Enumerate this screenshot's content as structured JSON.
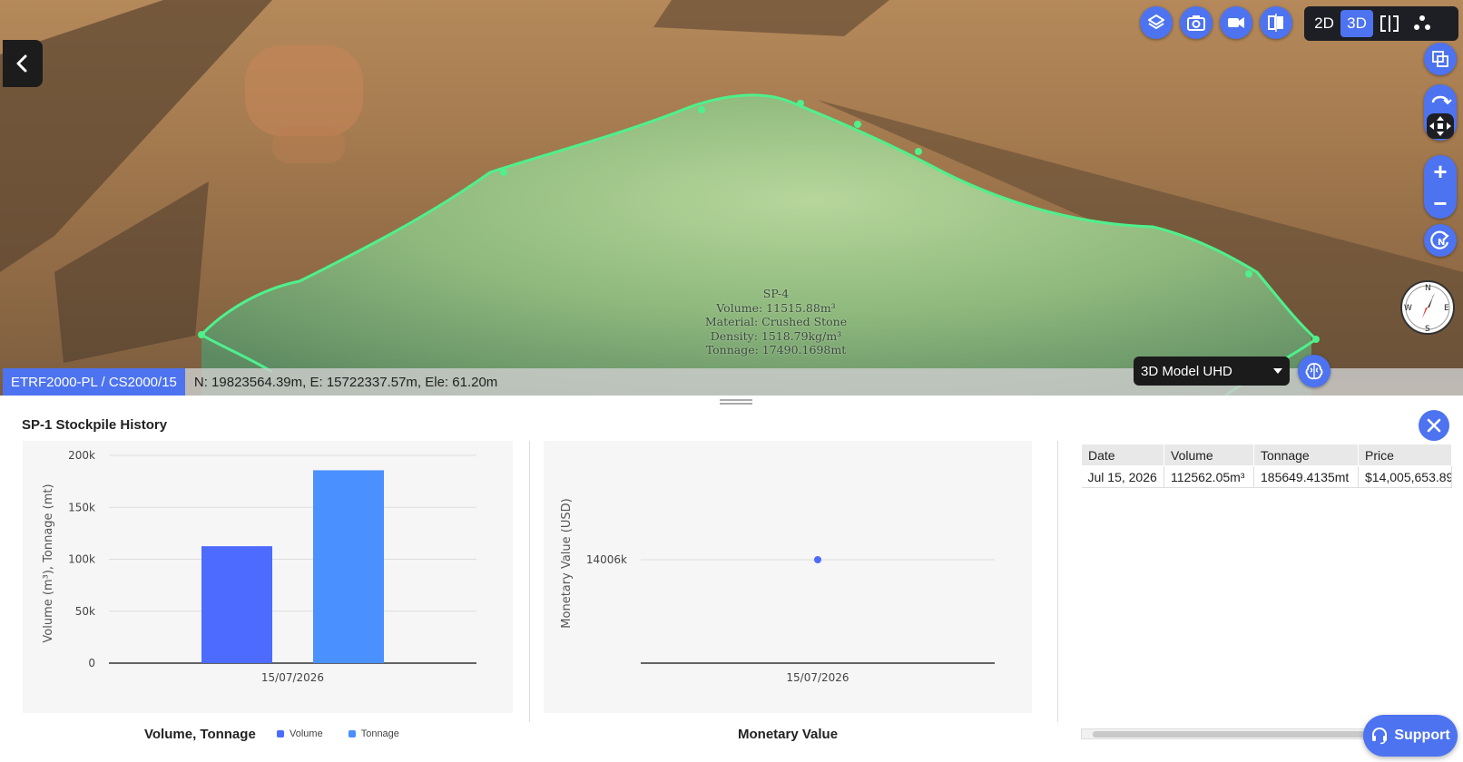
{
  "viewer": {
    "stockpile_label": [
      "SP-4",
      "Volume: 11515.88m³",
      "Material: Crushed Stone",
      "Density: 1518.79kg/m³",
      "Tonnage: 17490.1698mt"
    ],
    "mode_2d": "2D",
    "mode_3d": "3D",
    "active_mode": "3D",
    "crs": "ETRF2000-PL / CS2000/15",
    "coordinates": "N: 19823564.39m, E: 15722337.57m, Ele: 61.20m",
    "model_quality": "3D Model UHD",
    "compass": {
      "n": "N",
      "e": "E",
      "s": "S",
      "w": "W"
    },
    "zoom_in": "+",
    "zoom_out": "−"
  },
  "panel": {
    "title": "SP-1 Stockpile History",
    "support_label": "Support"
  },
  "charts": {
    "volume_caption": "Volume, Tonnage",
    "monetary_caption": "Monetary Value"
  },
  "chart_data": [
    {
      "type": "bar",
      "categories": [
        "15/07/2026"
      ],
      "series": [
        {
          "name": "Volume",
          "values": [
            112562.05
          ],
          "color": "#4d6bff"
        },
        {
          "name": "Tonnage",
          "values": [
            185649.4135
          ],
          "color": "#4a90ff"
        }
      ],
      "ylabel": "Volume (m³), Tonnage (mt)",
      "ylim": [
        0,
        200000
      ],
      "yticks": [
        "0",
        "50k",
        "100k",
        "150k",
        "200k"
      ],
      "grid": true,
      "legend": "bottom"
    },
    {
      "type": "scatter",
      "categories": [
        "15/07/2026"
      ],
      "values": [
        14005.65389
      ],
      "ylabel": "Monetary Value (USD)",
      "yticks": [
        "14006k"
      ],
      "point_color": "#4d6bff",
      "grid": true
    }
  ],
  "table": {
    "headers": [
      "Date",
      "Volume",
      "Tonnage",
      "Price"
    ],
    "rows": [
      [
        "Jul 15, 2026",
        "112562.05m³",
        "185649.4135mt",
        "$14,005,653.89"
      ]
    ]
  },
  "colors": {
    "accent": "#4d73f0",
    "dark": "#1d1f24",
    "boundary": "#4ff08c"
  }
}
